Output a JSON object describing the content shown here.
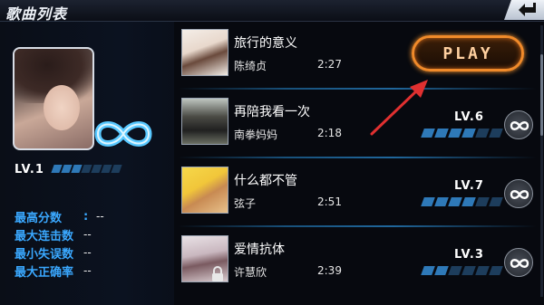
{
  "header": {
    "title": "歌曲列表",
    "back_icon": "back-arrow-icon"
  },
  "player": {
    "level_label": "LV.1",
    "level_progress": 0.43,
    "mode_icon": "infinity-icon",
    "stats": [
      {
        "label": "最高分数",
        "colon": ":",
        "value": "--"
      },
      {
        "label": "最大连击数",
        "colon": ":",
        "value": "--"
      },
      {
        "label": "最小失误数",
        "colon": ":",
        "value": "--"
      },
      {
        "label": "最大正确率",
        "colon": ":",
        "value": "--"
      }
    ]
  },
  "songs": [
    {
      "title": "旅行的意义",
      "artist": "陈绮贞",
      "duration": "2:27",
      "action": "PLAY",
      "locked": false
    },
    {
      "title": "再陪我看一次",
      "artist": "南拳妈妈",
      "duration": "2:18",
      "level": "LV.6",
      "level_progress": 0.55,
      "locked": false
    },
    {
      "title": "什么都不管",
      "artist": "弦子",
      "duration": "2:51",
      "level": "LV.7",
      "level_progress": 0.64,
      "locked": false
    },
    {
      "title": "爱情抗体",
      "artist": "许慧欣",
      "duration": "2:39",
      "level": "LV.3",
      "level_progress": 0.27,
      "locked": true
    }
  ],
  "colors": {
    "accent_blue": "#3aa8ff",
    "play_orange": "#f08a2a",
    "annotation_red": "#e03030"
  }
}
